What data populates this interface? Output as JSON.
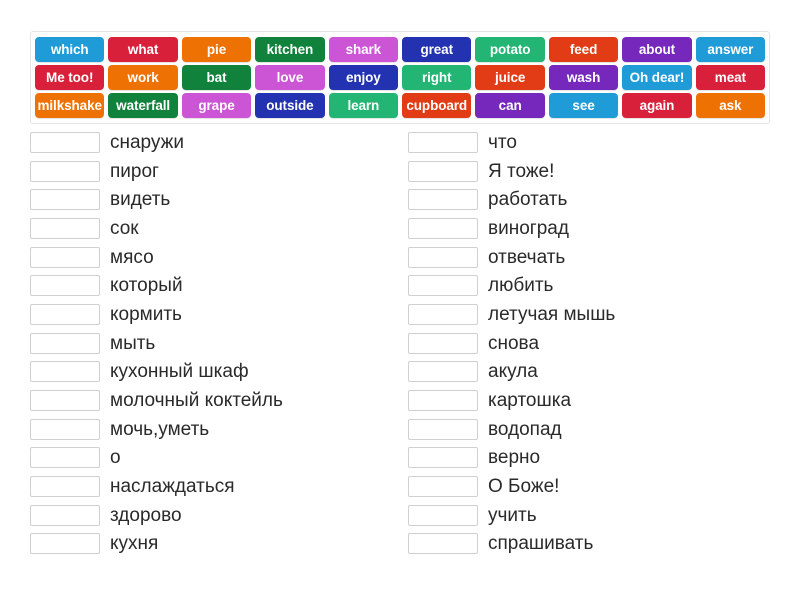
{
  "tile_bank": {
    "rows": [
      [
        {
          "label": "which",
          "color": "#1f9bd8"
        },
        {
          "label": "what",
          "color": "#d8203a"
        },
        {
          "label": "pie",
          "color": "#ee7203"
        },
        {
          "label": "kitchen",
          "color": "#11823b"
        },
        {
          "label": "shark",
          "color": "#cb55d4"
        },
        {
          "label": "great",
          "color": "#2332b0"
        },
        {
          "label": "potato",
          "color": "#23b573"
        },
        {
          "label": "feed",
          "color": "#e13c16"
        },
        {
          "label": "about",
          "color": "#7528bb"
        },
        {
          "label": "answer",
          "color": "#1f9bd8"
        }
      ],
      [
        {
          "label": "Me too!",
          "color": "#d8203a"
        },
        {
          "label": "work",
          "color": "#ee7203"
        },
        {
          "label": "bat",
          "color": "#11823b"
        },
        {
          "label": "love",
          "color": "#cb55d4"
        },
        {
          "label": "enjoy",
          "color": "#2332b0"
        },
        {
          "label": "right",
          "color": "#23b573"
        },
        {
          "label": "juice",
          "color": "#e13c16"
        },
        {
          "label": "wash",
          "color": "#7528bb"
        },
        {
          "label": "Oh dear!",
          "color": "#1f9bd8"
        },
        {
          "label": "meat",
          "color": "#d8203a"
        }
      ],
      [
        {
          "label": "milkshake",
          "color": "#ee7203"
        },
        {
          "label": "waterfall",
          "color": "#11823b"
        },
        {
          "label": "grape",
          "color": "#cb55d4"
        },
        {
          "label": "outside",
          "color": "#2332b0"
        },
        {
          "label": "learn",
          "color": "#23b573"
        },
        {
          "label": "cupboard",
          "color": "#e13c16"
        },
        {
          "label": "can",
          "color": "#7528bb"
        },
        {
          "label": "see",
          "color": "#1f9bd8"
        },
        {
          "label": "again",
          "color": "#d8203a"
        },
        {
          "label": "ask",
          "color": "#ee7203"
        }
      ]
    ]
  },
  "match_columns": {
    "left": [
      {
        "answer": "",
        "label": "снаружи"
      },
      {
        "answer": "",
        "label": "пирог"
      },
      {
        "answer": "",
        "label": "видеть"
      },
      {
        "answer": "",
        "label": "сок"
      },
      {
        "answer": "",
        "label": "мясо"
      },
      {
        "answer": "",
        "label": "который"
      },
      {
        "answer": "",
        "label": "кормить"
      },
      {
        "answer": "",
        "label": "мыть"
      },
      {
        "answer": "",
        "label": "кухонный шкаф"
      },
      {
        "answer": "",
        "label": "молочный коктейль"
      },
      {
        "answer": "",
        "label": "мочь,уметь"
      },
      {
        "answer": "",
        "label": "о"
      },
      {
        "answer": "",
        "label": "наслаждаться"
      },
      {
        "answer": "",
        "label": "здорово"
      },
      {
        "answer": "",
        "label": "кухня"
      }
    ],
    "right": [
      {
        "answer": "",
        "label": "что"
      },
      {
        "answer": "",
        "label": "Я тоже!"
      },
      {
        "answer": "",
        "label": "работать"
      },
      {
        "answer": "",
        "label": "виноград"
      },
      {
        "answer": "",
        "label": "отвечать"
      },
      {
        "answer": "",
        "label": "любить"
      },
      {
        "answer": "",
        "label": "летучая мышь"
      },
      {
        "answer": "",
        "label": "снова"
      },
      {
        "answer": "",
        "label": "акула"
      },
      {
        "answer": "",
        "label": "картошка"
      },
      {
        "answer": "",
        "label": "водопад"
      },
      {
        "answer": "",
        "label": "верно"
      },
      {
        "answer": "",
        "label": "О Боже!"
      },
      {
        "answer": "",
        "label": "учить"
      },
      {
        "answer": "",
        "label": "спрашивать"
      }
    ]
  }
}
